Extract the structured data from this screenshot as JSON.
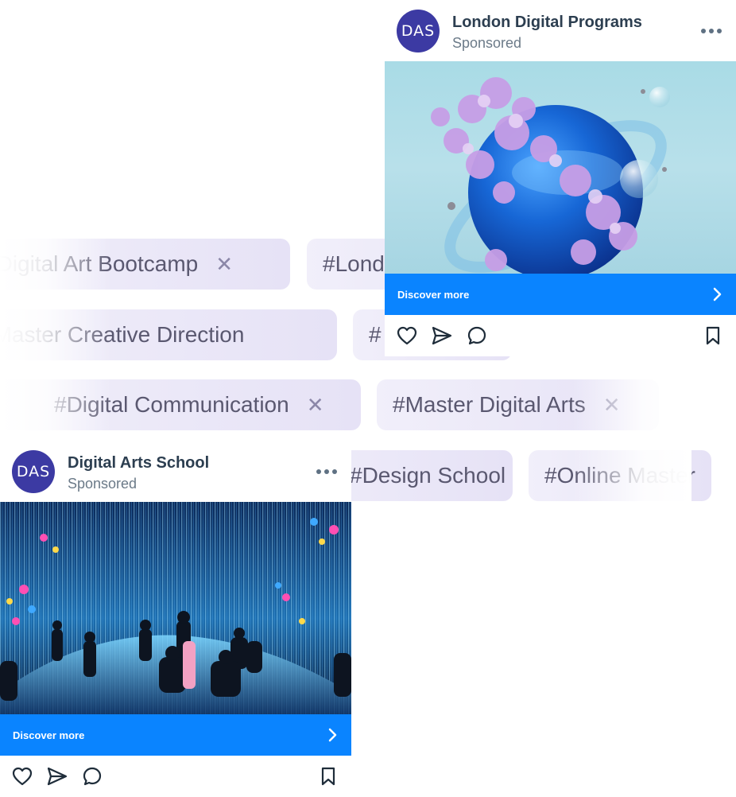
{
  "tags": {
    "row1": [
      {
        "text": "#Digital Art Bootcamp"
      },
      {
        "text": "#London Digital Arts"
      }
    ],
    "row2": [
      {
        "text": "#Master Creative Direction"
      },
      {
        "text": "#"
      }
    ],
    "row3": [
      {
        "text": "#Digital Communication"
      },
      {
        "text": "#Master Digital Arts"
      }
    ],
    "row4": [
      {
        "text": "#Design School"
      },
      {
        "text": "#Online Master"
      }
    ],
    "close_glyph": "✕"
  },
  "ads": [
    {
      "avatar_text": "DAS",
      "brand": "London Digital Programs",
      "label": "Sponsored",
      "cta": "Discover more",
      "media_icon": "blue-sphere-with-flowers-image"
    },
    {
      "avatar_text": "DAS",
      "brand": "Digital Arts School",
      "label": "Sponsored",
      "cta": "Discover more",
      "media_icon": "immersive-light-installation-image"
    }
  ],
  "colors": {
    "cta": "#0a84ff",
    "avatar": "#3c3aa3",
    "chip": "#e6e2f6"
  }
}
